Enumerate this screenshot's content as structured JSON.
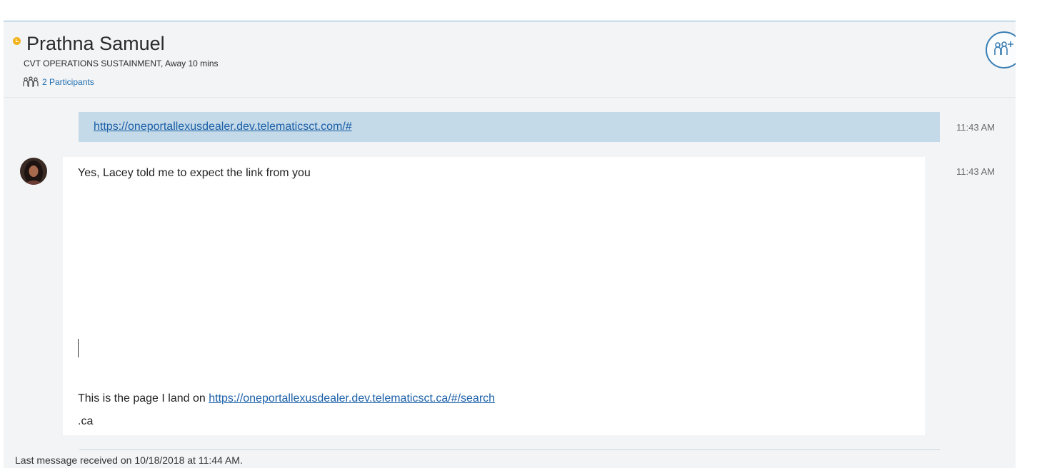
{
  "header": {
    "contact_name": "Prathna Samuel",
    "status": "CVT OPERATIONS SUSTAINMENT, Away 10 mins",
    "participants_label": "2 Participants",
    "presence_color": "#f2b31d"
  },
  "icons": {
    "presence": "away-clock-icon",
    "participants": "people-icon",
    "add_people": "add-people-icon"
  },
  "messages": {
    "sent_link": {
      "text": "https://oneportallexusdealer.dev.telematicsct.com/#",
      "time": "11:43 AM"
    },
    "reply": {
      "time": "11:43 AM",
      "line1": "Yes, Lacey told me to expect the link from you",
      "line2_prefix": "This is the page I land on ",
      "line2_link": "https://oneportallexusdealer.dev.telematicsct.ca/#/search",
      "line3": ".ca"
    }
  },
  "footer": {
    "note": "Last message received on 10/18/2018 at 11:44 AM."
  },
  "colors": {
    "accent": "#3a7eb4",
    "link": "#1a5fa8",
    "sent_bubble": "#c5dae8"
  }
}
